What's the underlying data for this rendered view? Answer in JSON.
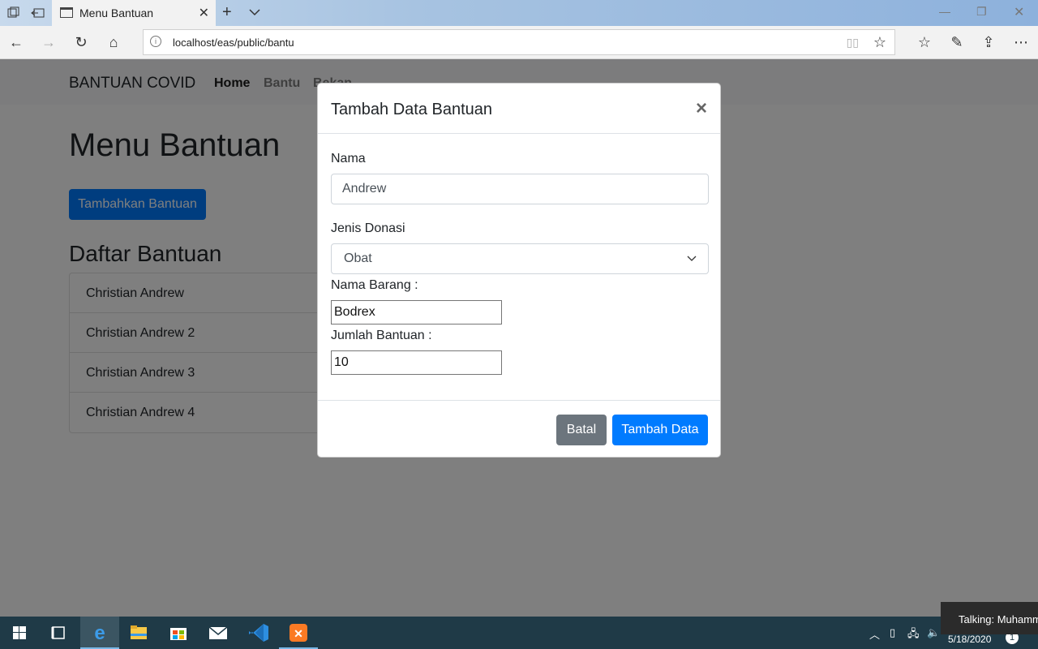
{
  "browser": {
    "tab_title": "Menu Bantuan",
    "url": "localhost/eas/public/bantu"
  },
  "navbar": {
    "brand": "BANTUAN COVID",
    "links": [
      "Home",
      "Bantu",
      "Bekan"
    ]
  },
  "page": {
    "title": "Menu Bantuan",
    "add_button": "Tambahkan Bantuan",
    "list_title": "Daftar Bantuan",
    "list_items": [
      "Christian Andrew",
      "Christian Andrew 2",
      "Christian Andrew 3",
      "Christian Andrew 4"
    ]
  },
  "modal": {
    "title": "Tambah Data Bantuan",
    "close": "×",
    "nama_label": "Nama",
    "nama_value": "Andrew",
    "jenis_label": "Jenis Donasi",
    "jenis_value": "Obat",
    "barang_label": "Nama Barang :",
    "barang_value": "Bodrex",
    "jumlah_label": "Jumlah Bantuan :",
    "jumlah_value": "10",
    "cancel_label": "Batal",
    "submit_label": "Tambah Data"
  },
  "taskbar": {
    "clock": "5/18/2020",
    "notification": "Talking: Muhamm",
    "notification_count": "1"
  },
  "colors": {
    "primary": "#007bff",
    "secondary": "#6c757d",
    "taskbar": "#1f3a47"
  }
}
